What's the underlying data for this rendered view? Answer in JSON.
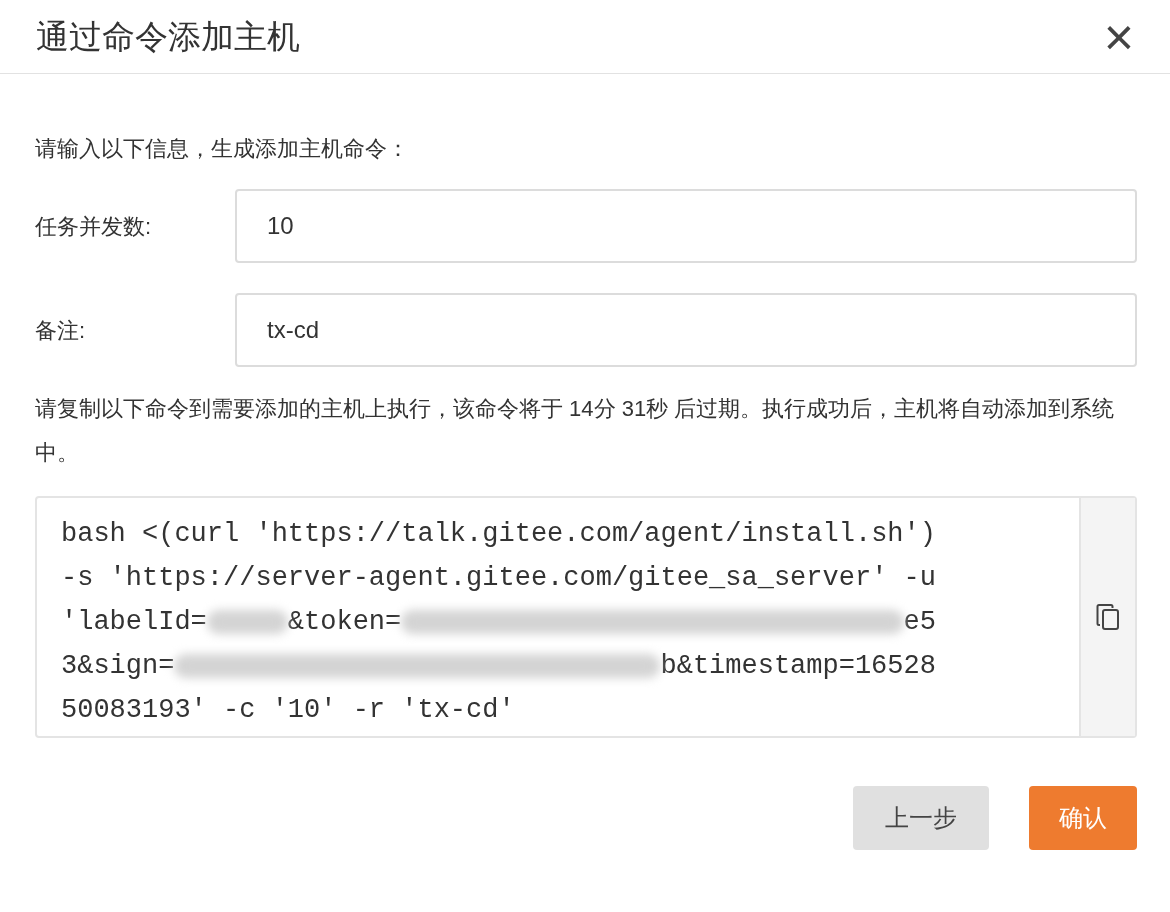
{
  "dialog": {
    "title": "通过命令添加主机",
    "close": "×"
  },
  "intro": "请输入以下信息，生成添加主机命令：",
  "fields": [
    {
      "label": "任务并发数:",
      "value": "10"
    },
    {
      "label": "备注:",
      "value": "tx-cd"
    }
  ],
  "instruction": "请复制以下命令到需要添加的主机上执行，该命令将于 14分 31秒 后过期。执行成功后，主机将自动添加到系统中。",
  "command_lines": [
    [
      {
        "kind": "text",
        "text": "bash <(curl 'https://talk.gitee.com/agent/install.sh')"
      }
    ],
    [
      {
        "kind": "text",
        "text": "-s 'https://server-agent.gitee.com/gitee_sa_server' -u"
      }
    ],
    [
      {
        "kind": "text",
        "text": "'labelId="
      },
      {
        "kind": "redacted"
      },
      {
        "kind": "text",
        "text": "&token="
      },
      {
        "kind": "redacted"
      },
      {
        "kind": "text",
        "text": "e5"
      }
    ],
    [
      {
        "kind": "text",
        "text": "3&sign="
      },
      {
        "kind": "redacted"
      },
      {
        "kind": "text",
        "text": "b&timestamp=16528"
      }
    ],
    [
      {
        "kind": "text",
        "text": "50083193' -c '10' -r 'tx-cd'"
      }
    ]
  ],
  "buttons": [
    {
      "label": "上一步",
      "kind": "secondary"
    },
    {
      "label": "确认",
      "kind": "primary"
    }
  ]
}
